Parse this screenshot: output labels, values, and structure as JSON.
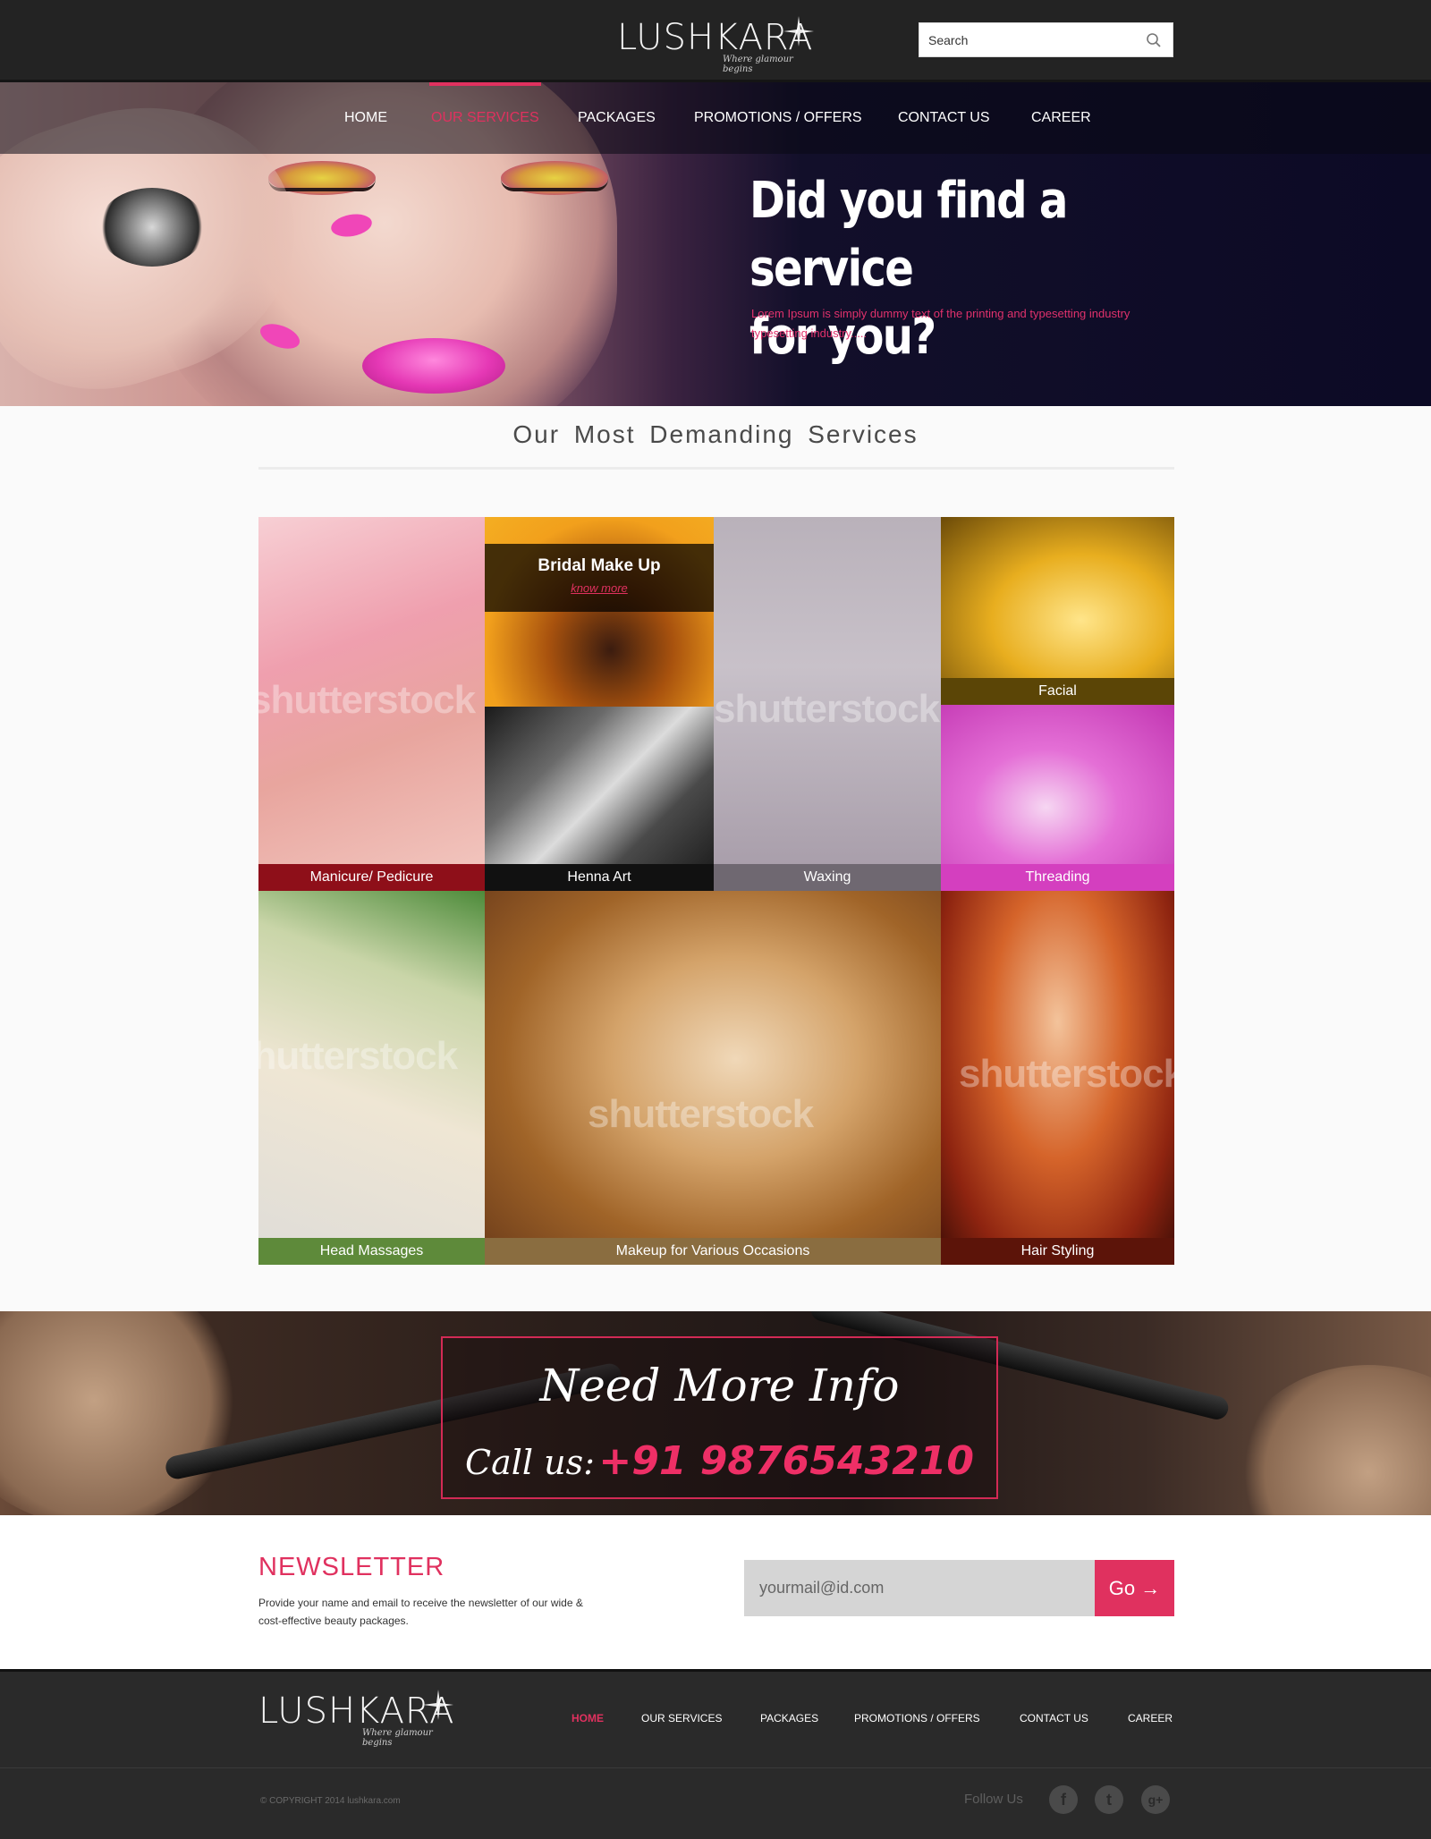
{
  "header": {
    "logo_text": "LUSHKARA",
    "logo_tagline": "Where glamour begins",
    "search_placeholder": "Search"
  },
  "nav": {
    "items": [
      {
        "label": "HOME",
        "active": false
      },
      {
        "label": "OUR SERVICES",
        "active": true
      },
      {
        "label": "PACKAGES",
        "active": false
      },
      {
        "label": "PROMOTIONS / OFFERS",
        "active": false
      },
      {
        "label": "CONTACT US",
        "active": false
      },
      {
        "label": "CAREER",
        "active": false
      }
    ]
  },
  "hero": {
    "heading_line1": "Did you find a service",
    "heading_line2": "for you?",
    "subtext": "Lorem Ipsum is simply dummy text of the printing and typesetting industry typesetting industry....."
  },
  "services": {
    "title": "Our Most Demanding Services",
    "featured": {
      "title": "Bridal Make Up",
      "link": "know more"
    },
    "tiles": [
      {
        "caption": "Manicure/ Pedicure"
      },
      {
        "caption": "Henna  Art"
      },
      {
        "caption": "Waxing"
      },
      {
        "caption": "Facial"
      },
      {
        "caption": "Threading"
      },
      {
        "caption": "Head Massages"
      },
      {
        "caption": "Makeup for Various Occasions"
      },
      {
        "caption": "Hair Styling"
      }
    ],
    "watermark": "shutterstock"
  },
  "info_banner": {
    "headline": "Need More Info",
    "call_label": "Call us:",
    "phone": "+91 9876543210"
  },
  "newsletter": {
    "title": "NEWSLETTER",
    "description": "Provide your name and email to receive the newsletter of our wide & cost-effective beauty packages.",
    "email_placeholder": "yourmail@id.com",
    "button_label": "Go →"
  },
  "footer": {
    "logo_text": "LUSHKARA",
    "logo_tagline": "Where glamour begins",
    "nav": [
      {
        "label": "HOME",
        "active": true
      },
      {
        "label": "OUR SERVICES",
        "active": false
      },
      {
        "label": "PACKAGES",
        "active": false
      },
      {
        "label": "PROMOTIONS / OFFERS",
        "active": false
      },
      {
        "label": "CONTACT US",
        "active": false
      },
      {
        "label": "CAREER",
        "active": false
      }
    ],
    "copyright": "© COPYRIGHT 2014  lushkara.com",
    "follow_label": "Follow Us",
    "social": [
      {
        "icon": "facebook-icon",
        "glyph": "f"
      },
      {
        "icon": "twitter-icon",
        "glyph": "t"
      },
      {
        "icon": "google-plus-icon",
        "glyph": "g+"
      }
    ]
  },
  "colors": {
    "accent": "#e0315f",
    "header_bg": "#232323",
    "footer_bg": "#2a2a2a"
  }
}
